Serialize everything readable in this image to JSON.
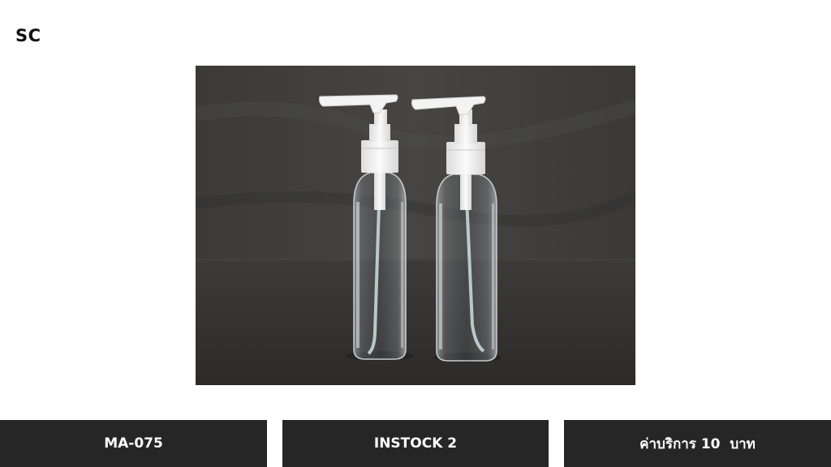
{
  "brand": {
    "logo_text": "SC"
  },
  "product": {
    "image_name": "two-clear-pump-bottles-photo",
    "code": "MA-075",
    "stock": "INSTOCK 2",
    "price": "ค่าบริการ 10  บาท"
  },
  "colors": {
    "backdrop": "#3a3a3a",
    "table": "#2f2f2f",
    "info_box": "#262626",
    "info_text": "#ffffff",
    "pump": "#f2f2f2"
  }
}
